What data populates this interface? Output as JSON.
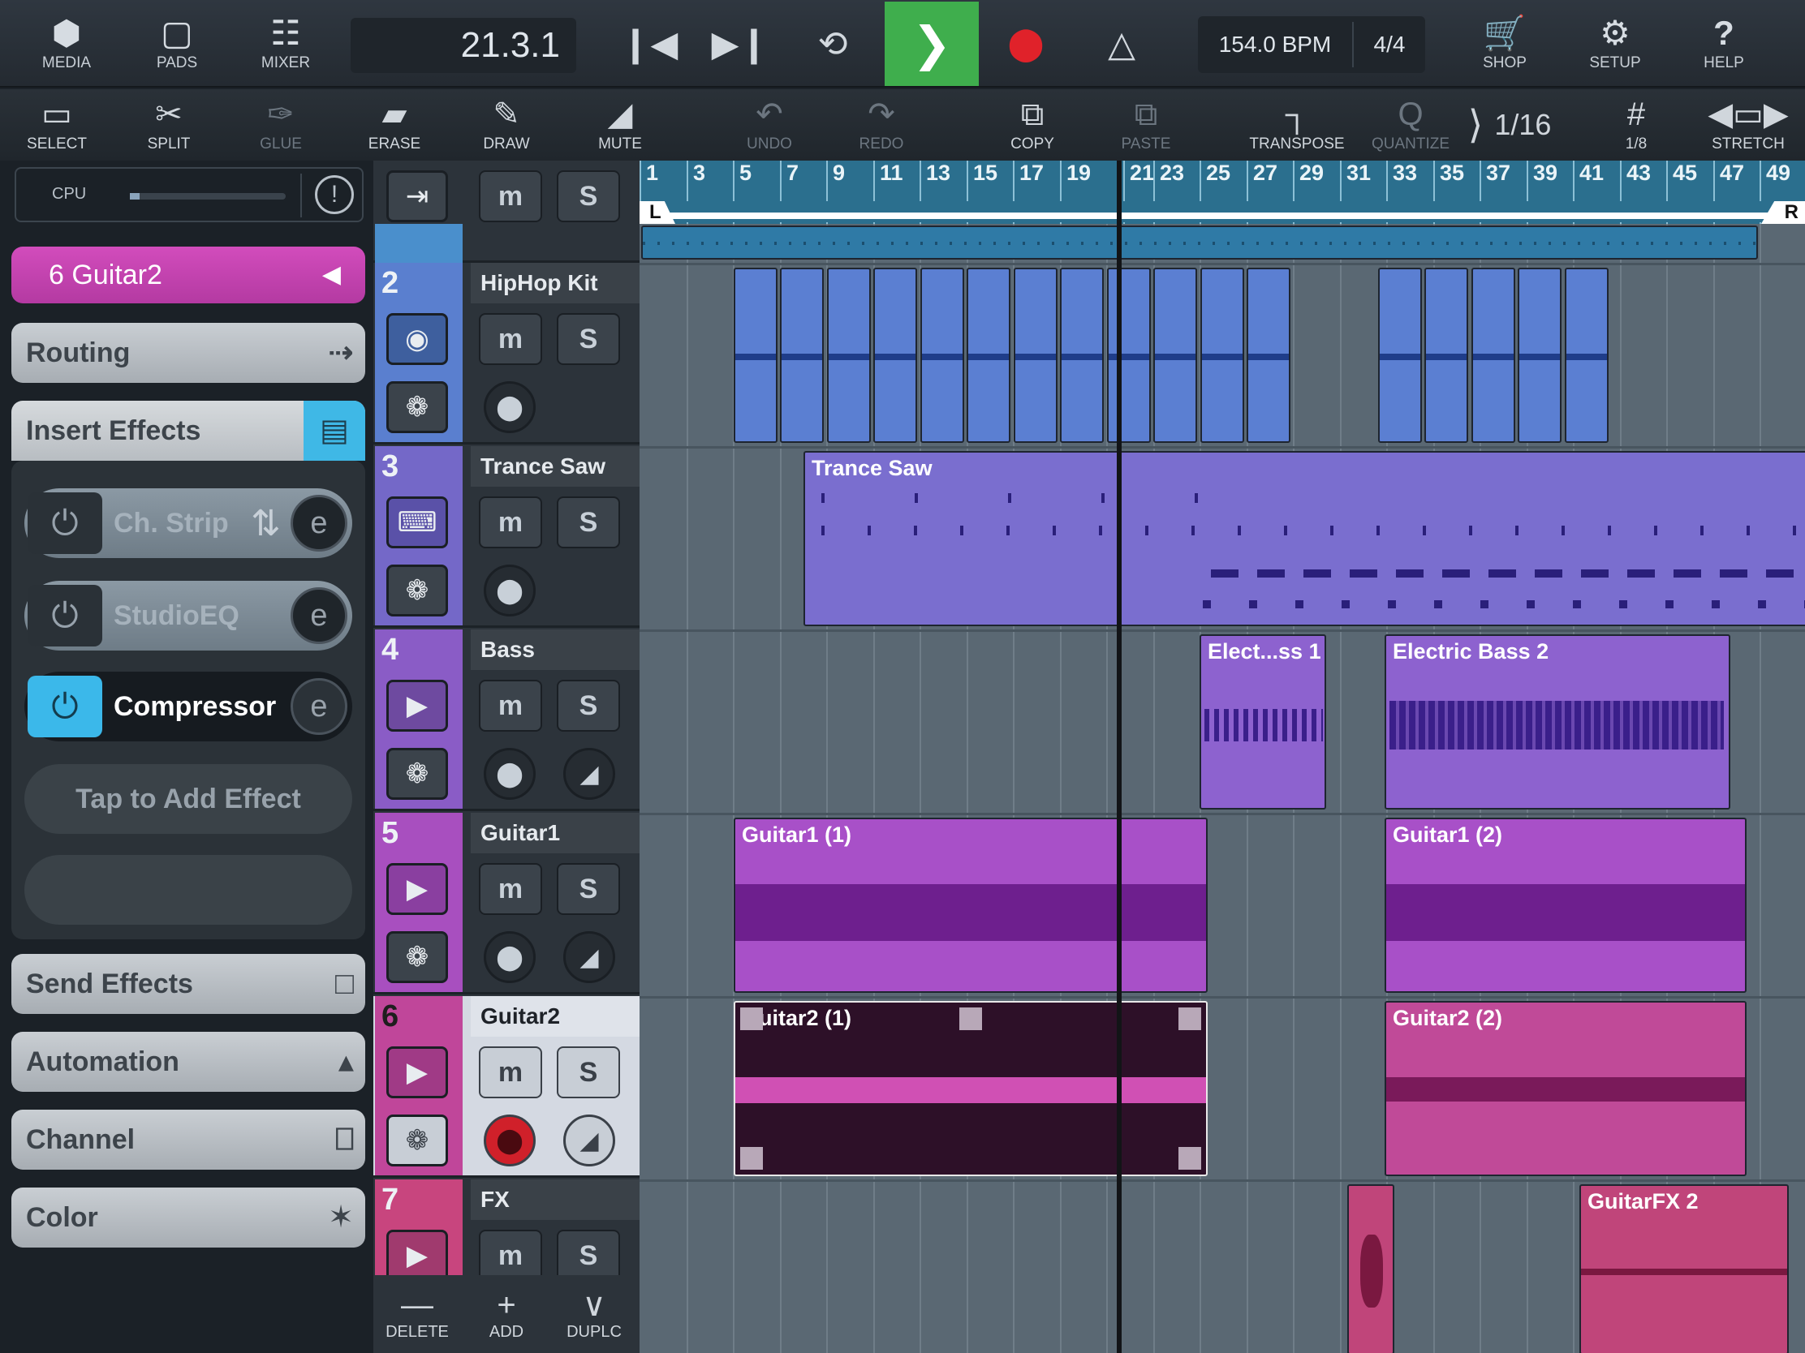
{
  "topbar": {
    "media": "MEDIA",
    "pads": "PADS",
    "mixer": "MIXER",
    "position": "21.3.1",
    "bpm": "154.0 BPM",
    "signature": "4/4",
    "shop": "SHOP",
    "setup": "SETUP",
    "help": "HELP"
  },
  "toolbar": {
    "select": "SELECT",
    "split": "SPLIT",
    "glue": "GLUE",
    "erase": "ERASE",
    "draw": "DRAW",
    "mute": "MUTE",
    "undo": "UNDO",
    "redo": "REDO",
    "copy": "COPY",
    "paste": "PASTE",
    "transpose": "TRANSPOSE",
    "quantize": "QUANTIZE",
    "quantize_value": "1/16",
    "grid_value": "1/8",
    "stretch": "STRETCH"
  },
  "left": {
    "cpu": "CPU",
    "track_title": "6  Guitar2",
    "routing": "Routing",
    "insert_effects": "Insert Effects",
    "effects": [
      {
        "name": "Ch. Strip",
        "active": false
      },
      {
        "name": "StudioEQ",
        "active": false
      },
      {
        "name": "Compressor",
        "active": true
      }
    ],
    "add_effect": "Tap to Add Effect",
    "send_effects": "Send Effects",
    "automation": "Automation",
    "channel": "Channel",
    "color": "Color"
  },
  "tracks": [
    {
      "num": "2",
      "name": "HipHop Kit",
      "color": "#5a7fcf",
      "icon": "drum-icon"
    },
    {
      "num": "3",
      "name": "Trance Saw",
      "color": "#7468c8",
      "icon": "synth-icon"
    },
    {
      "num": "4",
      "name": "Bass",
      "color": "#8a5cc6",
      "icon": "play-icon"
    },
    {
      "num": "5",
      "name": "Guitar1",
      "color": "#a84fbf",
      "icon": "play-icon"
    },
    {
      "num": "6",
      "name": "Guitar2",
      "color": "#c0469a",
      "icon": "play-icon"
    },
    {
      "num": "7",
      "name": "FX",
      "color": "#c8457e",
      "icon": "play-icon"
    }
  ],
  "track_buttons": {
    "mute": "m",
    "solo": "S"
  },
  "bottombar": {
    "delete": "DELETE",
    "add": "ADD",
    "duplicate": "DUPLC"
  },
  "ruler": {
    "bars": [
      "1",
      "3",
      "5",
      "7",
      "9",
      "11",
      "13",
      "15",
      "17",
      "19",
      "21",
      "23",
      "25",
      "27",
      "29",
      "31",
      "33",
      "35",
      "37",
      "39",
      "41",
      "43",
      "45",
      "47",
      "49"
    ],
    "left_locator": "L",
    "right_locator": "R"
  },
  "clips": {
    "trance_saw": "Trance Saw",
    "elect_bass_1": "Elect...ss 1",
    "electric_bass_2": "Electric Bass 2",
    "guitar1_1": "Guitar1 (1)",
    "guitar1_2": "Guitar1 (2)",
    "guitar2_1": "Guitar2 (1)",
    "guitar2_2": "Guitar2 (2)",
    "guitarfx_2": "GuitarFX 2"
  }
}
